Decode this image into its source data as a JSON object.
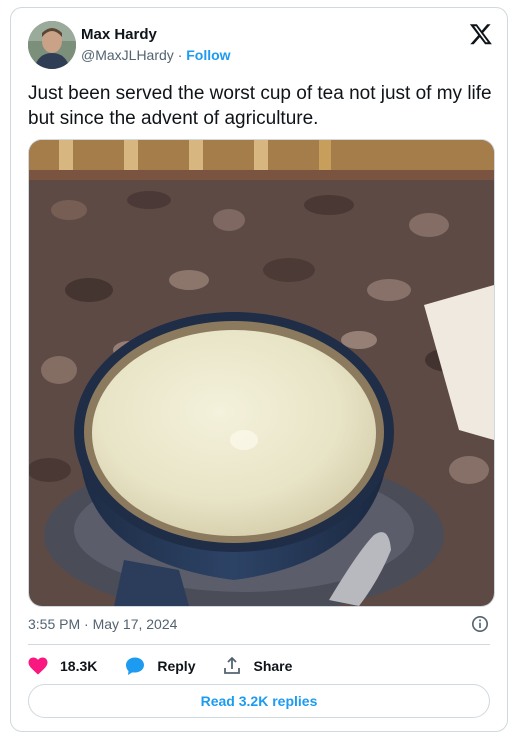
{
  "author": {
    "name": "Max Hardy",
    "handle": "@MaxJLHardy",
    "separator": "·",
    "follow_label": "Follow"
  },
  "tweet": {
    "text": "Just been served the worst cup of tea not just of my life but since the advent of agriculture.",
    "timestamp": "3:55 PM · May 17, 2024"
  },
  "actions": {
    "likes_count": "18.3K",
    "reply_label": "Reply",
    "share_label": "Share"
  },
  "read_replies_label": "Read 3.2K replies",
  "colors": {
    "accent": "#1d9bf0",
    "like": "#f91880",
    "muted_text": "#536471",
    "border": "#cfd9de"
  },
  "icons": [
    "x-logo-icon",
    "info-icon",
    "heart-icon",
    "reply-bubble-icon",
    "share-icon"
  ]
}
